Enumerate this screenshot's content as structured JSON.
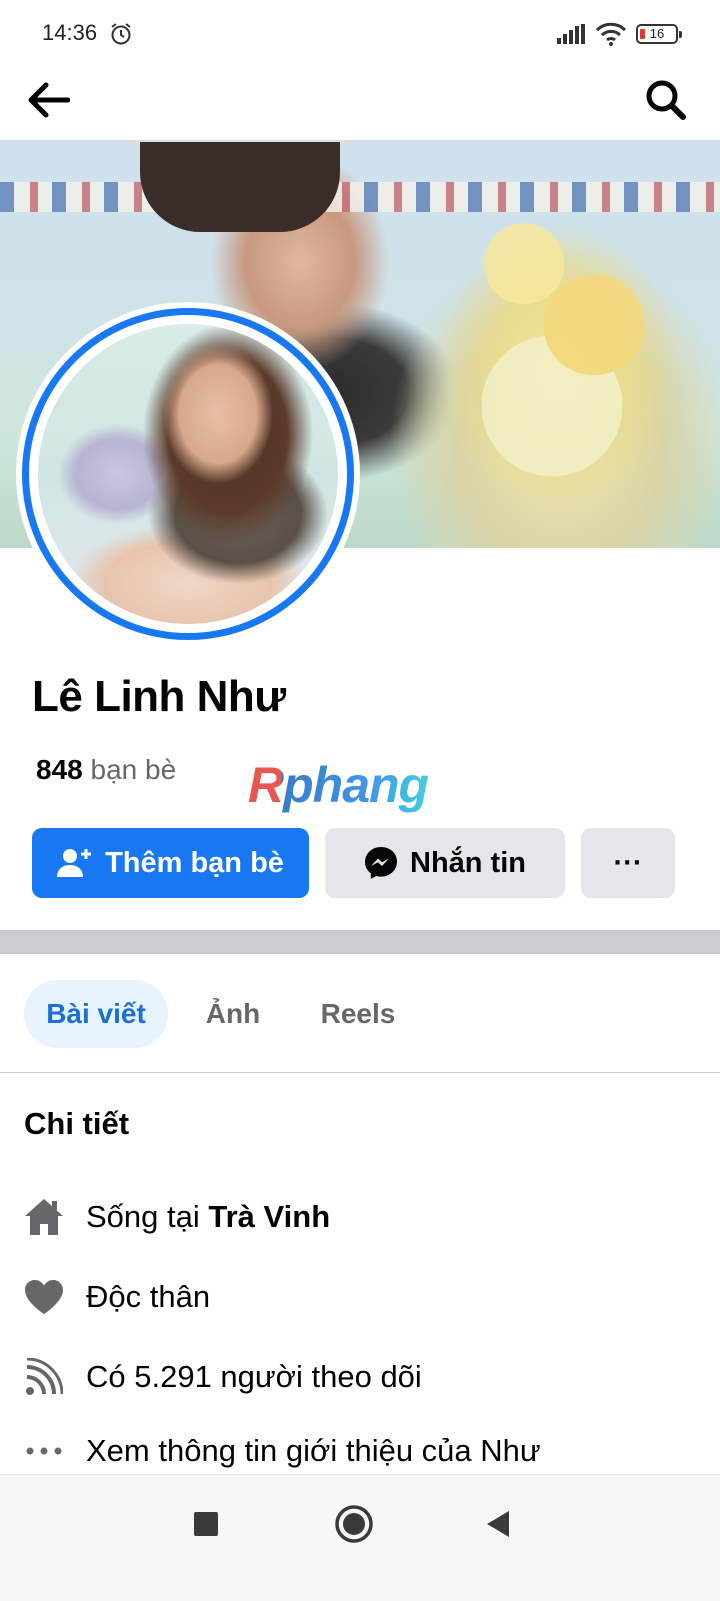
{
  "status_bar": {
    "time": "14:36",
    "battery_level": "16",
    "icons": [
      "alarm-icon",
      "signal-icon",
      "wifi-icon",
      "battery-icon"
    ]
  },
  "app_bar": {
    "icons": [
      "back-arrow-icon",
      "search-icon"
    ]
  },
  "profile": {
    "name": "Lê Linh Như",
    "friend_count": "848",
    "friend_label": "bạn bè",
    "watermark": "Rphang"
  },
  "actions": {
    "add_friend_label": "Thêm bạn bè",
    "message_label": "Nhắn tin",
    "more_label": "···"
  },
  "tabs": [
    {
      "label": "Bài viết",
      "selected": true
    },
    {
      "label": "Ảnh",
      "selected": false
    },
    {
      "label": "Reels",
      "selected": false
    }
  ],
  "details": {
    "heading": "Chi tiết",
    "lives_in_prefix": "Sống tại",
    "lives_in_place": "Trà Vinh",
    "relationship": "Độc thân",
    "followers": "Có 5.291 người theo dõi",
    "see_about": "Xem thông tin giới thiệu của Như"
  },
  "colors": {
    "accent": "#1877f2",
    "secondary_button": "#e4e6eb",
    "selected_tab_bg": "#e7f3ff",
    "muted_text": "#65676b"
  }
}
